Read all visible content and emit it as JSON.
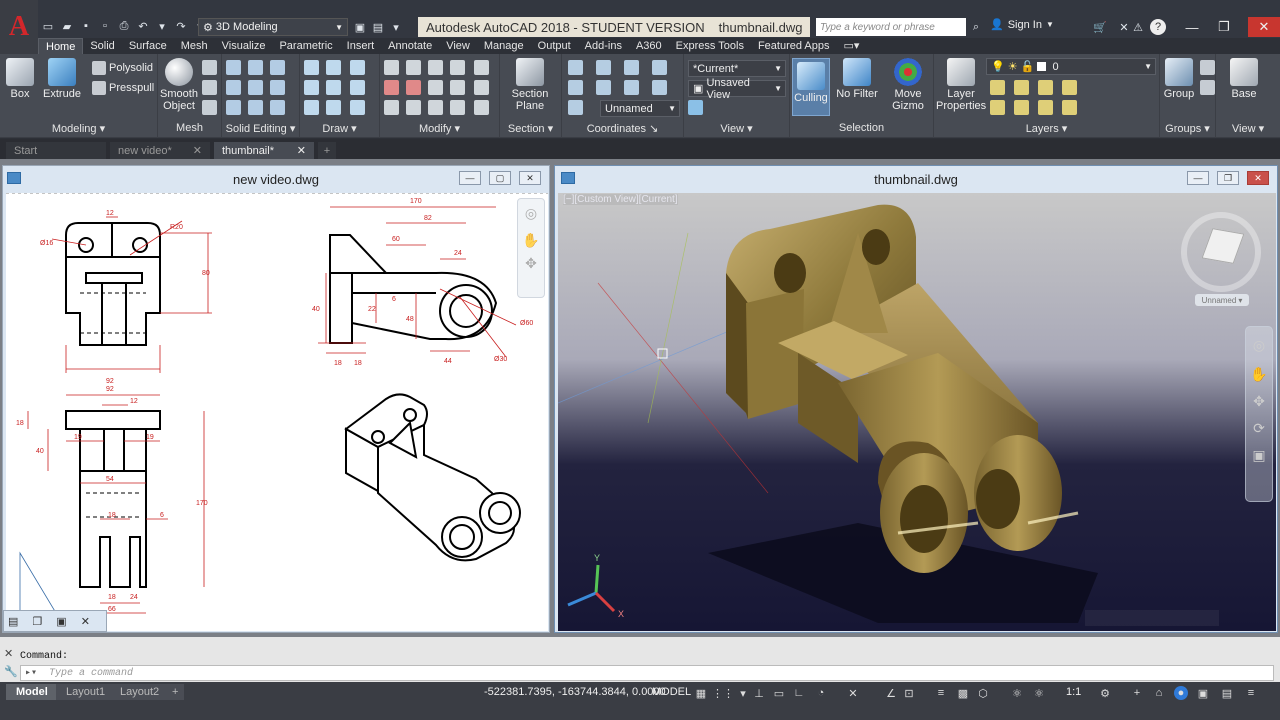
{
  "app": {
    "logo_letter": "A",
    "title": "Autodesk AutoCAD 2018 - STUDENT VERSION",
    "filename": "thumbnail.dwg",
    "workspace": "3D Modeling",
    "search_placeholder": "Type a keyword or phrase",
    "sign_in": "Sign In"
  },
  "ribbon_tabs": [
    "Home",
    "Solid",
    "Surface",
    "Mesh",
    "Visualize",
    "Parametric",
    "Insert",
    "Annotate",
    "View",
    "Manage",
    "Output",
    "Add-ins",
    "A360",
    "Express Tools",
    "Featured Apps"
  ],
  "panels": {
    "modeling": {
      "label": "Modeling",
      "box": "Box",
      "extrude": "Extrude",
      "polysolid": "Polysolid",
      "presspull": "Presspull"
    },
    "mesh": {
      "label": "Mesh",
      "smooth1": "Smooth",
      "smooth2": "Object"
    },
    "solid_editing": {
      "label": "Solid Editing"
    },
    "draw": {
      "label": "Draw"
    },
    "modify": {
      "label": "Modify"
    },
    "section": {
      "label": "Section",
      "plane1": "Section",
      "plane2": "Plane"
    },
    "coordinates": {
      "label": "Coordinates",
      "ucs_value": "Unnamed"
    },
    "view": {
      "label": "View",
      "visual_style": "*Current*",
      "named_view": "Unsaved View"
    },
    "selection": {
      "label": "Selection",
      "culling": "Culling",
      "nofilter": "No Filter",
      "gizmo1": "Move",
      "gizmo2": "Gizmo"
    },
    "layers": {
      "label": "Layers",
      "props1": "Layer",
      "props2": "Properties",
      "layer_value": "0"
    },
    "groups": {
      "label": "Groups",
      "group": "Group"
    },
    "view2": {
      "label": "View",
      "base": "Base"
    }
  },
  "doc_tabs": [
    "Start",
    "new video*",
    "thumbnail*"
  ],
  "windows": {
    "left_title": "new video.dwg",
    "right_title": "thumbnail.dwg",
    "viewport_label": "[−][Custom View][Current]",
    "viewcube_label": "Unnamed"
  },
  "dims": {
    "d12a": "12",
    "r20": "R20",
    "d16": "Ø16",
    "d80": "80",
    "d92a": "92",
    "d170a": "170",
    "d82": "82",
    "d60": "60",
    "d24a": "24",
    "d40a": "40",
    "d22": "22",
    "d6a": "6",
    "d48": "48",
    "d18a": "18",
    "d18b": "18",
    "d44": "44",
    "d60b": "Ø60",
    "d30": "Ø30",
    "d92b": "92",
    "d12b": "12",
    "d18c": "18",
    "d40b": "40",
    "d19a": "19",
    "d19b": "19",
    "d54": "54",
    "d170b": "170",
    "d18d": "18",
    "d6b": "6",
    "d18e": "18",
    "d24b": "24",
    "d66": "66"
  },
  "command": {
    "history": "Command:",
    "placeholder": "Type a command"
  },
  "status": {
    "layouts": [
      "Model",
      "Layout1",
      "Layout2"
    ],
    "coords": "-522381.7395, -163744.3844, 0.0000",
    "model": "MODEL",
    "scale": "1:1"
  },
  "colors": {
    "accent_red": "#d4272b",
    "ribbon_bg": "#474b53",
    "dim_red": "#c81e1e",
    "model_gold": "#8f7a3c"
  }
}
